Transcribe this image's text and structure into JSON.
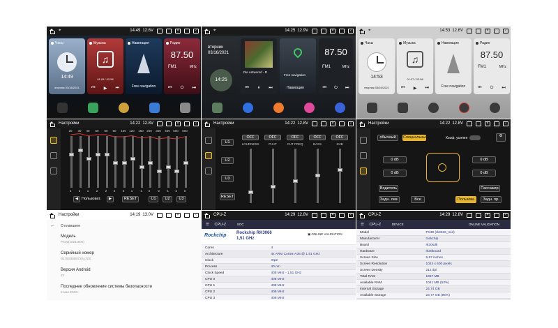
{
  "colors": {
    "accent": "#e8b52a",
    "dark_bg": "#151515",
    "status_bar": "#1a1a1a",
    "cpuz_header": "#2a2a40",
    "link_blue": "#283a8a"
  },
  "home1": {
    "status": {
      "time": "14:49",
      "battery": "12.6V"
    },
    "clock_card": {
      "title": "Часы",
      "time": "14:49",
      "date": "вторник 03/16/2021"
    },
    "music_card": {
      "title": "Музыка",
      "progress": "01:09 / 02:56"
    },
    "nav_card": {
      "title": "Навигация",
      "label": "Free navigation"
    },
    "radio_card": {
      "title": "Радио",
      "freq": "87.50",
      "band": "FM1",
      "unit": "MHz"
    }
  },
  "home2": {
    "status": {
      "time": "14:25",
      "battery": "12.9V"
    },
    "clock_card": {
      "day": "вторник",
      "date": "03/16/2021",
      "time": "14:25"
    },
    "music_card": {
      "track": "Die Antwoord - R"
    },
    "nav_card": {
      "label": "Free navigation",
      "title": "Навигация"
    },
    "radio_card": {
      "freq": "87.50",
      "band": "FM1",
      "unit": "MHz"
    }
  },
  "home3": {
    "status": {
      "time": "14:53",
      "battery": "12.6V"
    },
    "clock_card": {
      "title": "Часы",
      "time": "14:53",
      "date": "вторник 03/16/2021"
    },
    "music_card": {
      "title": "Музыка",
      "progress": "01:37 / 02:56"
    },
    "nav_card": {
      "title": "Навигация",
      "label": "Free navigation"
    },
    "radio_card": {
      "title": "Радио",
      "freq": "87.50",
      "band": "FM1",
      "unit": "MHz"
    }
  },
  "eq1": {
    "status": {
      "title": "Настройки",
      "time": "14:22",
      "battery": "12.8V"
    },
    "freqs": [
      "20",
      "30",
      "40",
      "50",
      "60",
      "80",
      "100",
      "120",
      "150",
      "200",
      "300",
      "400",
      "500",
      "600"
    ],
    "levels": [
      2,
      3,
      1,
      2,
      2,
      0,
      0,
      1,
      -1,
      0,
      -2,
      -1,
      -2,
      0
    ],
    "preset_label": "Пользоват.",
    "reset_label": "RESET",
    "u1": "U1",
    "u2": "U2",
    "u3": "U3"
  },
  "eq2": {
    "status": {
      "title": "Настройки",
      "time": "14:22",
      "battery": "12.8V"
    },
    "presets": [
      "U1",
      "U2",
      "U3"
    ],
    "reset_label": "RESET",
    "columns": [
      {
        "state": "OFF",
        "label": "LOUDNESS"
      },
      {
        "state": "OFF",
        "label": "PHAT"
      },
      {
        "state": "OFF",
        "label": "CUT FREQ"
      },
      {
        "state": "OFF",
        "label": "BASS"
      },
      {
        "state": "OFF",
        "label": "SUB"
      }
    ]
  },
  "balance": {
    "status": {
      "title": "Настройки",
      "time": "14:22",
      "battery": "12.8V"
    },
    "mode_normal": "обычный",
    "mode_special": "Специальный",
    "amp_label": "Коэф. усилен",
    "values": [
      "0 dB",
      "0 dB",
      "0 dB",
      "0 dB"
    ],
    "seat_driver": "Водитель",
    "seat_passenger": "Пассажир",
    "rear_left": "Задн. лев.",
    "all": "Все",
    "custom": "Пользова",
    "rear_right": "Задн. пр."
  },
  "about": {
    "status": {
      "title": "Настройки",
      "time": "14:19",
      "battery": "13.0V"
    },
    "header": "О планшете",
    "rows": [
      {
        "label": "Модель",
        "value": "PX30(1024x600)"
      },
      {
        "label": "Серийный номер",
        "value": "D17B938D9720A7D0"
      },
      {
        "label": "Версия Android",
        "value": "10"
      },
      {
        "label": "Последнее обновление системы безопасности",
        "value": "5 мая 2020 г."
      }
    ]
  },
  "cpuz_soc": {
    "status": {
      "title": "CPU-Z",
      "time": "14:29",
      "battery": "12.8V"
    },
    "tab": "SOC",
    "brand": "Rockchip",
    "chip": "Rockchip RK3066",
    "freq": "1,51 GHz",
    "validation": "ONLINE VALIDATION",
    "rows": [
      {
        "k": "Cores",
        "v": "4"
      },
      {
        "k": "Architecture",
        "v": "4x ARM Cortex-A35 @ 1.51 GHz"
      },
      {
        "k": "Clock",
        "v": "r0p2"
      },
      {
        "k": "Process",
        "v": "40 nm"
      },
      {
        "k": "Clock Speed",
        "v": "408 MHz - 1,51 GHz"
      },
      {
        "k": "CPU 0",
        "v": "408 MHz"
      },
      {
        "k": "CPU 1",
        "v": "408 MHz"
      },
      {
        "k": "CPU 2",
        "v": "408 MHz"
      },
      {
        "k": "CPU 3",
        "v": "408 MHz"
      }
    ]
  },
  "cpuz_device": {
    "status": {
      "title": "CPU-Z",
      "time": "14:29",
      "battery": "12.8V"
    },
    "tab": "DEVICE",
    "validation": "ONLINE VALIDATION",
    "rows": [
      {
        "k": "Model",
        "v": "PX30 (rk3326_mid)"
      },
      {
        "k": "Manufacturer",
        "v": "rockchip"
      },
      {
        "k": "Board",
        "v": "rk30sdk"
      },
      {
        "k": "Hardware",
        "v": "rk30board"
      },
      {
        "k": "Screen Size",
        "v": "5,57 inches"
      },
      {
        "k": "Screen Resolution",
        "v": "1024 x 600 pixels"
      },
      {
        "k": "Screen Density",
        "v": "212 dpi"
      },
      {
        "k": "Total RAM",
        "v": "1957 MB"
      },
      {
        "k": "Available RAM",
        "v": "1041 MB (53%)"
      },
      {
        "k": "Internal Storage",
        "v": "24,74 GB"
      },
      {
        "k": "Available Storage",
        "v": "23,77 GB (96%)"
      }
    ]
  }
}
